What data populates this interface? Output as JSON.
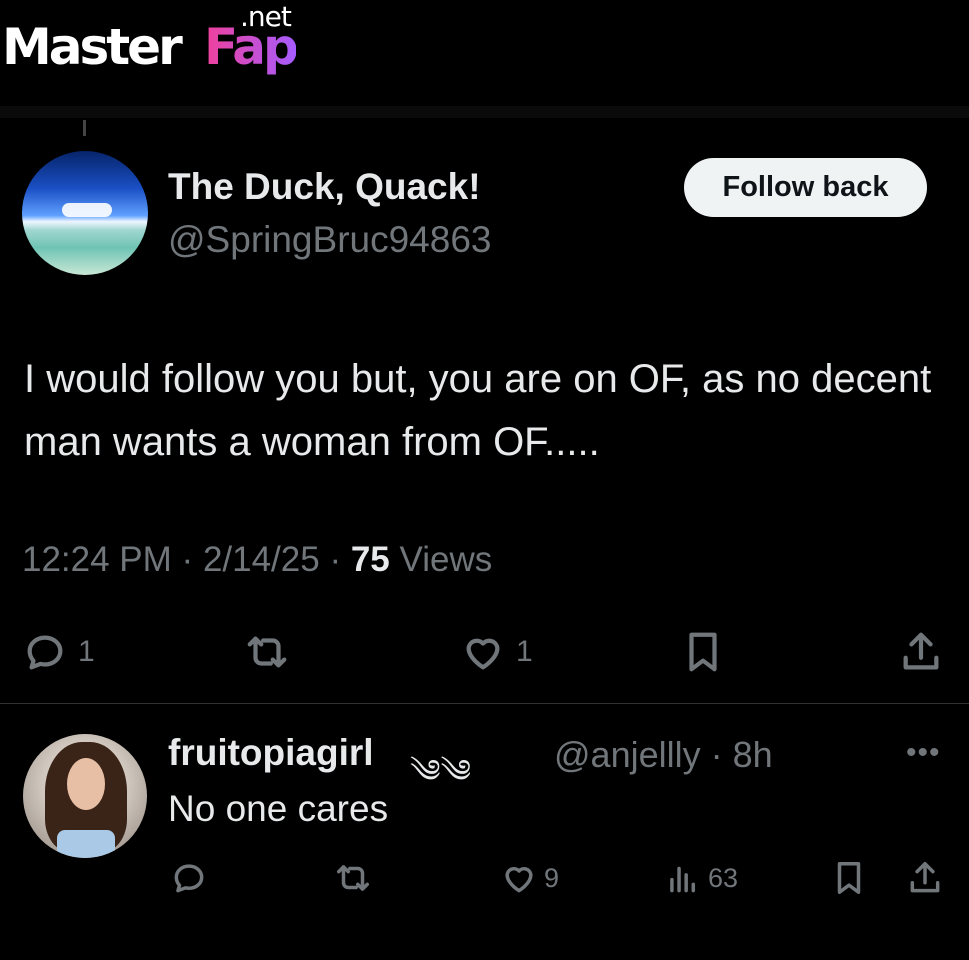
{
  "watermark": {
    "master": "Master",
    "fap": "Fap",
    "net": ".net"
  },
  "tweet": {
    "display_name": "The Duck, Quack!",
    "handle": "@SpringBruc94863",
    "follow_button": "Follow back",
    "text": "I would follow you but, you are on OF, as no decent man wants a woman from OF.....",
    "time": "12:24 PM",
    "date": "2/14/25",
    "views_count": "75",
    "views_label": "Views",
    "replies": "1",
    "likes": "1",
    "icons": [
      "reply-icon",
      "retweet-icon",
      "like-icon",
      "bookmark-icon",
      "share-icon"
    ]
  },
  "reply": {
    "display_name": "fruitopiagirl",
    "decoration": "༄༄",
    "handle": "@anjellly",
    "age": "8h",
    "more": "•••",
    "text": "No one cares",
    "likes": "9",
    "views": "63",
    "icons": [
      "reply-icon",
      "retweet-icon",
      "like-icon",
      "analytics-icon",
      "bookmark-icon",
      "share-icon"
    ]
  },
  "colors": {
    "background": "#000000",
    "text": "#e7e9ea",
    "muted": "#71767b",
    "divider": "#2f3336",
    "button": "#eff3f4"
  }
}
